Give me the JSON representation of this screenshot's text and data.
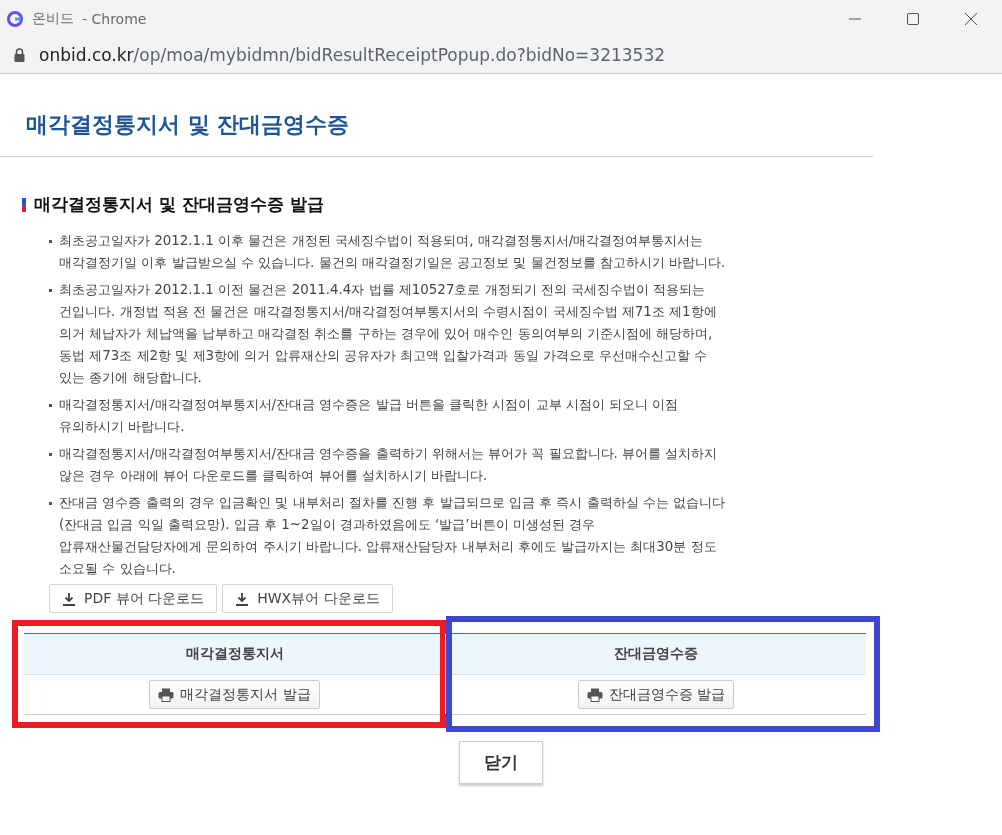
{
  "window": {
    "title": "온비드",
    "app": "- Chrome",
    "url_host": "onbid.co.kr",
    "url_path": "/op/moa/mybidmn/bidResultReceiptPopup.do?bidNo=3213532"
  },
  "page_title": "매각결정통지서 및 잔대금영수증",
  "section_title": "매각결정통지서 및 잔대금영수증 발급",
  "notes": [
    {
      "lines": [
        "최초공고일자가 2012.1.1 이후 물건은 개정된 국세징수법이 적용되며, 매각결정통지서/매각결정여부통지서는",
        "매각결정기일 이후 발급받으실 수 있습니다. 물건의 매각결정기일은 공고정보 및 물건정보를 참고하시기 바랍니다."
      ]
    },
    {
      "lines": [
        "최초공고일자가 2012.1.1 이전 물건은 2011.4.4자 법률 제10527호로 개정되기 전의 국세징수법이 적용되는",
        "건입니다. 개정법 적용 전 물건은 매각결정통지서/매각결정여부통지서의 수령시점이 국세징수법 제71조 제1항에",
        "의거 체납자가 체납액을 납부하고 매각결정 취소를 구하는 경우에 있어 매수인 동의여부의 기준시점에 해당하며,",
        "동법 제73조 제2항 및 제3항에 의거 압류재산의 공유자가 최고액 입찰가격과 동일 가격으로 우선매수신고할 수",
        "있는 종기에 해당합니다."
      ]
    },
    {
      "lines": [
        "매각결정통지서/매각결정여부통지서/잔대금 영수증은 발급 버튼을 클릭한 시점이 교부 시점이 되오니 이점",
        "유의하시기 바랍니다."
      ]
    },
    {
      "lines": [
        "매각결정통지서/매각결정여부통지서/잔대금 영수증을 출력하기 위해서는 뷰어가 꼭 필요합니다. 뷰어를 설치하지",
        "않은 경우 아래에 뷰어 다운로드를 클릭하여 뷰어를 설치하시기 바랍니다."
      ]
    },
    {
      "lines": [
        "잔대금 영수증 출력의 경우 입금확인 및 내부처리 절차를 진행 후 발급되므로 입금 후 즉시 출력하실 수는 없습니다",
        "(잔대금 입금 익일 출력요망). 입금 후 1~2일이 경과하였음에도 ‘발급’버튼이 미생성된 경우",
        "압류재산물건담당자에게 문의하여 주시기 바랍니다. 압류재산담당자 내부처리 후에도 발급까지는 최대30분 정도",
        "소요될 수 있습니다."
      ]
    }
  ],
  "downloads": [
    "PDF 뷰어 다운로드",
    "HWX뷰어 다운로드"
  ],
  "columns": [
    {
      "header": "매각결정통지서",
      "button": "매각결정통지서 발급",
      "color": "#ed1c24"
    },
    {
      "header": "잔대금영수증",
      "button": "잔대금영수증 발급",
      "color": "#3f48cc"
    }
  ],
  "close_button": "닫기"
}
